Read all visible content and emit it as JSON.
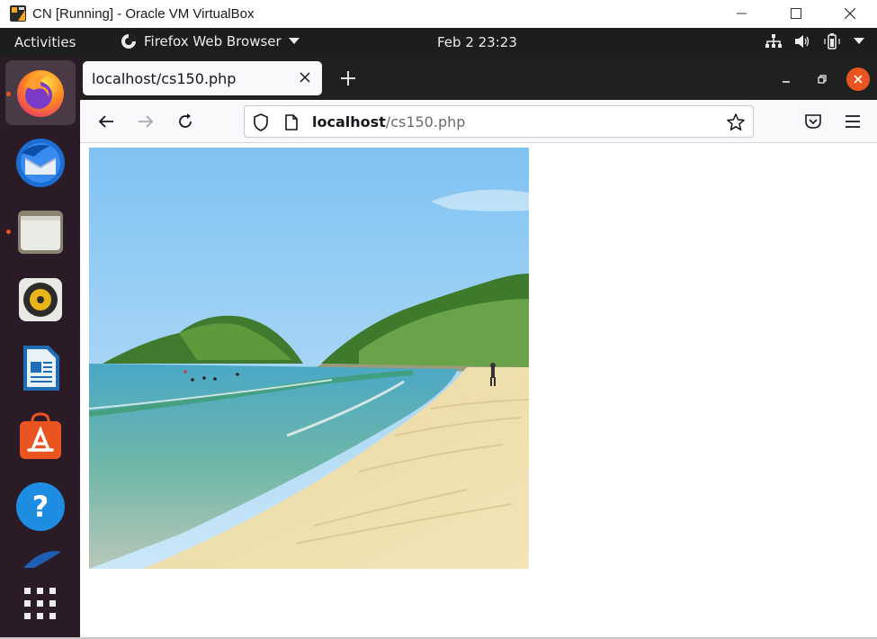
{
  "host_window": {
    "title": "CN [Running] - Oracle VM VirtualBox"
  },
  "gnome_bar": {
    "activities": "Activities",
    "app_name": "Firefox Web Browser",
    "clock": "Feb 2  23:23"
  },
  "dock": {
    "items": [
      "firefox-icon",
      "thunderbird-icon",
      "files-icon",
      "rhythmbox-icon",
      "libreoffice-writer-icon",
      "software-center-icon",
      "help-icon",
      "show-apps-icon"
    ]
  },
  "browser": {
    "tab_title": "localhost/cs150.php",
    "url_host": "localhost",
    "url_path": "/cs150.php"
  },
  "colors": {
    "ubuntu_orange": "#e95420",
    "dock_bg": "#2b1b26",
    "topbar_bg": "#1d1d1d"
  }
}
